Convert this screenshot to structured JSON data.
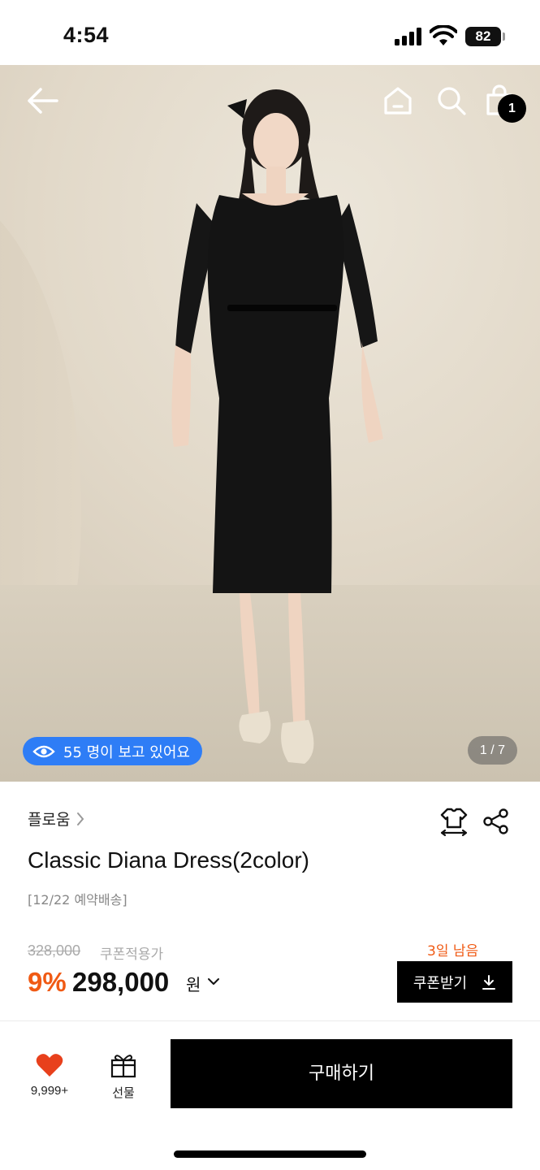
{
  "status_bar": {
    "time": "4:54",
    "battery": "82"
  },
  "top_nav": {
    "cart_count": "1"
  },
  "gallery": {
    "viewers_text": "55 명이 보고 있어요",
    "image_counter": "1 / 7"
  },
  "product": {
    "brand": "플로움",
    "title": "Classic Diana Dress(2color)",
    "delivery_note": "[12/22 예약배송]",
    "original_price": "328,000",
    "coupon_label": "쿠폰적용가",
    "discount_rate": "9%",
    "sale_price": "298,000",
    "currency": "원",
    "days_left": "3일 남음",
    "coupon_button_label": "쿠폰받기"
  },
  "bottom_bar": {
    "like_count": "9,999+",
    "gift_label": "선물",
    "buy_label": "구매하기"
  },
  "colors": {
    "accent": "#f05a14",
    "viewers_pill": "#2e7df6",
    "like_heart": "#e8401c"
  }
}
